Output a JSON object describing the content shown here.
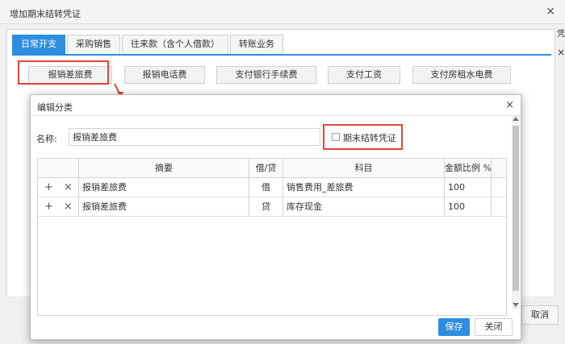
{
  "outer": {
    "title": "增加期末结转凭证",
    "close_glyph": "×",
    "edge_text": "凭",
    "edge_close": "×",
    "tabs": [
      "日常开支",
      "采购销售",
      "往来款（含个人借款）",
      "转账业务"
    ],
    "buttons": [
      "报销差旅费",
      "报销电话费",
      "支付银行手续费",
      "支付工资",
      "支付房租水电费"
    ],
    "cancel_label": "取消"
  },
  "dialog": {
    "title": "编辑分类",
    "close_glyph": "×",
    "name_label": "名称:",
    "name_value": "报销差旅费",
    "checkbox_label": "期末结转凭证",
    "checkbox_checked": false,
    "columns": [
      "摘要",
      "借/贷",
      "科目",
      "金额比例 %"
    ],
    "rows": [
      {
        "summary": "报销差旅费",
        "direction": "借",
        "account": "销售费用_差旅费",
        "ratio": "100"
      },
      {
        "summary": "报销差旅费",
        "direction": "贷",
        "account": "库存现金",
        "ratio": "100"
      }
    ],
    "save_label": "保存",
    "close_label": "关闭"
  },
  "colors": {
    "accent": "#2d8ee0",
    "highlight": "#e2453a"
  },
  "icons": {
    "add": "plus-icon",
    "remove": "times-icon"
  }
}
